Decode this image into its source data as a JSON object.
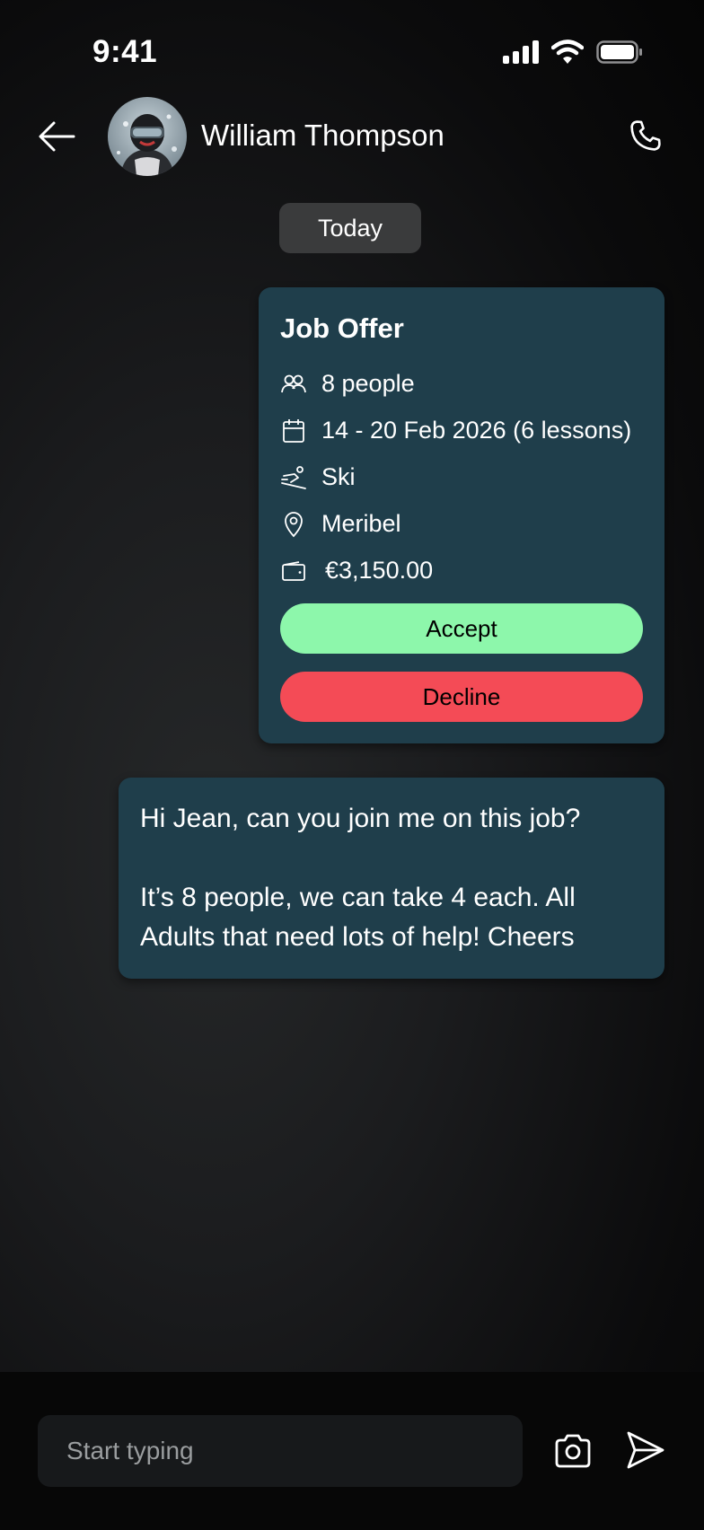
{
  "status_bar": {
    "time": "9:41"
  },
  "header": {
    "contact_name": "William Thompson"
  },
  "date_divider": "Today",
  "job_offer": {
    "title": "Job Offer",
    "people": "8 people",
    "dates": "14 - 20 Feb 2026 (6 lessons)",
    "sport": "Ski",
    "location": "Meribel",
    "price": "€3,150.00",
    "accept_label": "Accept",
    "decline_label": "Decline"
  },
  "message": {
    "text": "Hi Jean, can you join me on this job?\n\nIt’s 8 people, we can take 4 each. All Adults that need lots of help! Cheers"
  },
  "composer": {
    "placeholder": "Start typing"
  },
  "colors": {
    "bubble": "#1f3e4b",
    "accept": "#8df7ab",
    "decline": "#f44b56",
    "pill": "#3a3b3c"
  }
}
